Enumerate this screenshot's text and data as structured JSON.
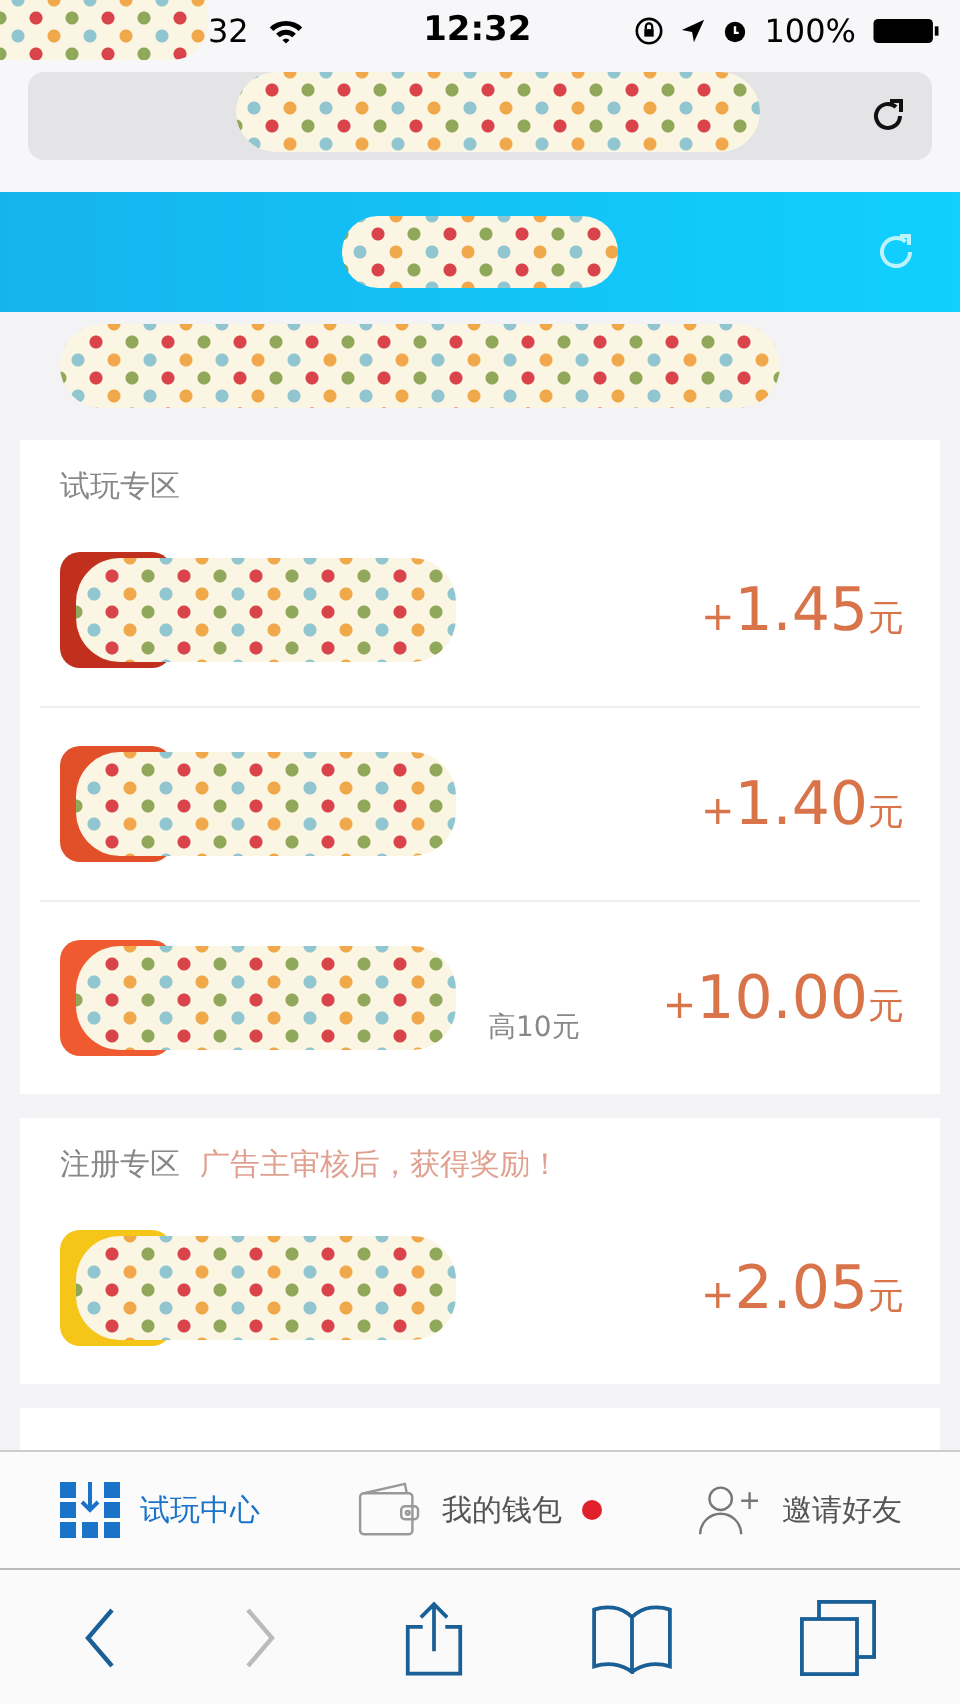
{
  "status_bar": {
    "carrier_fragment": "32",
    "time": "12:32",
    "battery": "100%"
  },
  "sections": [
    {
      "title": "试玩专区",
      "tasks": [
        {
          "color": "#c0301c",
          "reward": {
            "sign": "+",
            "amount": "1.45",
            "unit": "元"
          }
        },
        {
          "color": "#e2502a",
          "reward": {
            "sign": "+",
            "amount": "1.40",
            "unit": "元"
          }
        },
        {
          "color": "#f05a30",
          "extra": "高10元",
          "reward": {
            "sign": "+",
            "amount": "10.00",
            "unit": "元"
          }
        }
      ]
    },
    {
      "title": "注册专区",
      "note": "广告主审核后，获得奖励！",
      "tasks": [
        {
          "color": "#f5c518",
          "reward": {
            "sign": "+",
            "amount": "2.05",
            "unit": "元"
          }
        }
      ]
    }
  ],
  "tab_bar": [
    {
      "label": "试玩中心",
      "kind": "grid",
      "selected": true,
      "badge": false
    },
    {
      "label": "我的钱包",
      "kind": "wallet",
      "selected": false,
      "badge": true
    },
    {
      "label": "邀请好友",
      "kind": "invite",
      "selected": false,
      "badge": false
    }
  ],
  "browser_toolbar": {
    "back_enabled": true,
    "forward_enabled": false
  }
}
